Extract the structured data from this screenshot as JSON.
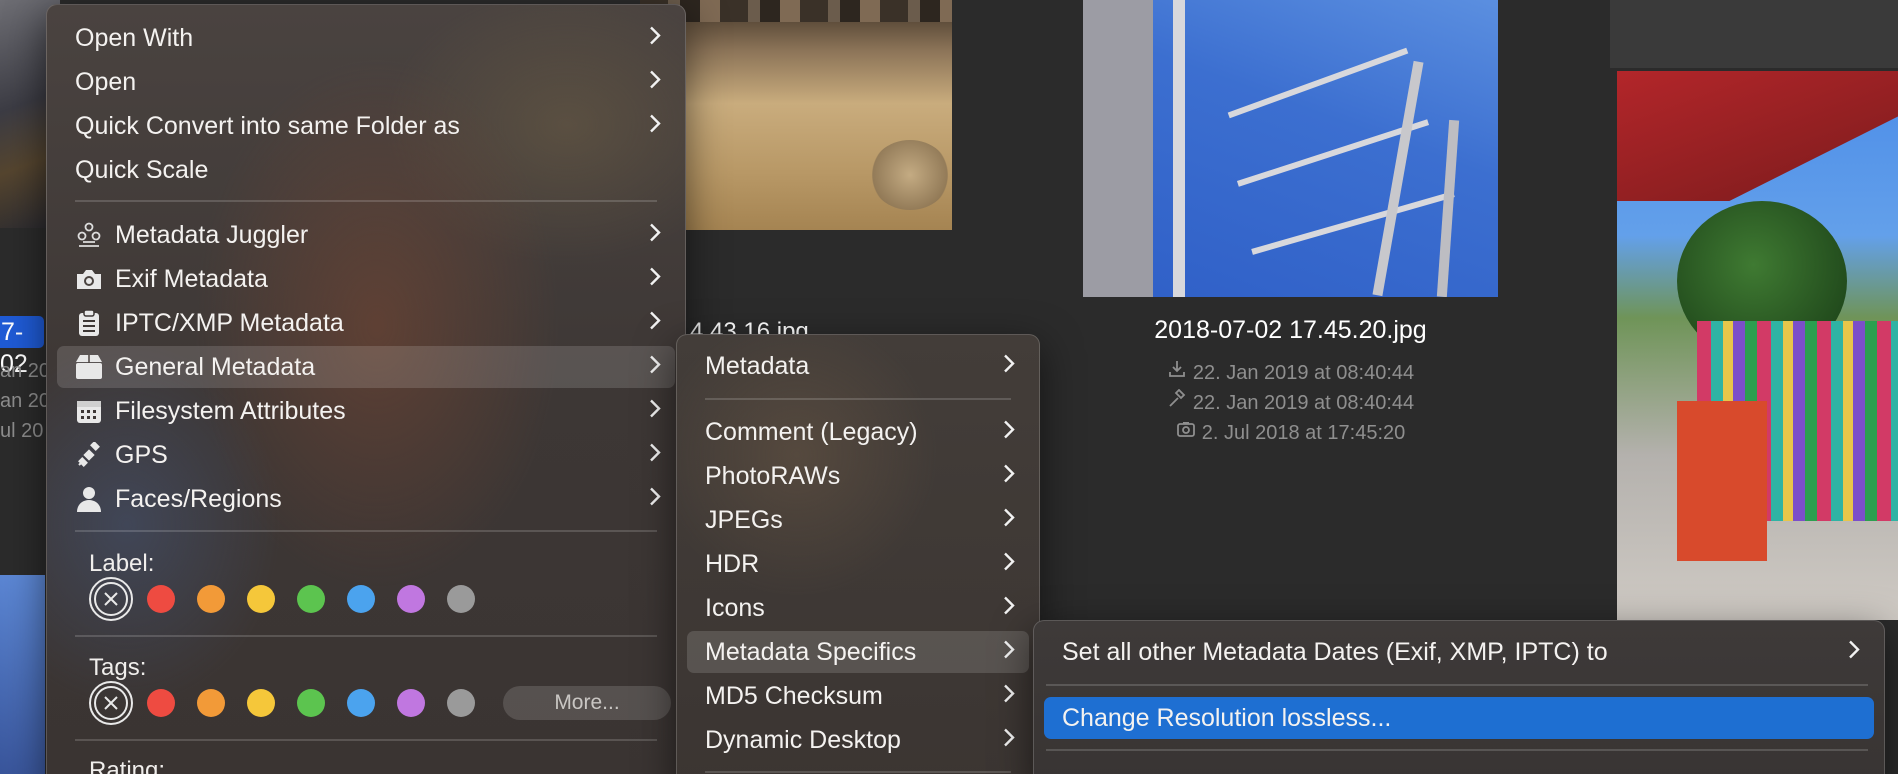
{
  "background": {
    "selected_label_partial": "7-02",
    "left_meta": [
      "an 20",
      "an 20",
      "ul 20"
    ],
    "partial_file_label": "4.43.16.jpg",
    "file": {
      "name": "2018-07-02 17.45.20.jpg",
      "dates": [
        {
          "icon": "download-icon",
          "text": "22. Jan 2019 at 08:40:44"
        },
        {
          "icon": "hammer-icon",
          "text": "22. Jan 2019 at 08:40:44"
        },
        {
          "icon": "camera-icon",
          "text": "2. Jul 2018 at 17:45:20"
        }
      ]
    }
  },
  "main_menu": {
    "items_top": [
      {
        "label": "Open With",
        "submenu": true
      },
      {
        "label": "Open",
        "submenu": true
      },
      {
        "label": "Quick Convert into same Folder as",
        "submenu": true
      },
      {
        "label": "Quick Scale",
        "submenu": false
      }
    ],
    "items_metadata": [
      {
        "label": "Metadata Juggler",
        "icon": "juggler-icon",
        "submenu": true
      },
      {
        "label": "Exif Metadata",
        "icon": "camera-icon",
        "submenu": true
      },
      {
        "label": "IPTC/XMP Metadata",
        "icon": "clipboard-icon",
        "submenu": true
      },
      {
        "label": "General Metadata",
        "icon": "box-icon",
        "submenu": true,
        "highlighted": true
      },
      {
        "label": "Filesystem Attributes",
        "icon": "calendar-icon",
        "submenu": true
      },
      {
        "label": "GPS",
        "icon": "satellite-icon",
        "submenu": true
      },
      {
        "label": "Faces/Regions",
        "icon": "person-icon",
        "submenu": true
      }
    ],
    "label_section": {
      "title": "Label:"
    },
    "tags_section": {
      "title": "Tags:",
      "more_button": "More..."
    },
    "rating_section": {
      "title": "Rating:"
    },
    "color_swatches": [
      "#ee4b41",
      "#f29a38",
      "#f5c73a",
      "#5cc44f",
      "#4ba3ee",
      "#c077e0",
      "#9a9a9a"
    ]
  },
  "submenu_general": {
    "items": [
      {
        "label": "Metadata",
        "submenu": true
      },
      {
        "label": "Comment (Legacy)",
        "submenu": true
      },
      {
        "label": "PhotoRAWs",
        "submenu": true
      },
      {
        "label": "JPEGs",
        "submenu": true
      },
      {
        "label": "HDR",
        "submenu": true
      },
      {
        "label": "Icons",
        "submenu": true
      },
      {
        "label": "Metadata Specifics",
        "submenu": true,
        "highlighted": true
      },
      {
        "label": "MD5 Checksum",
        "submenu": true
      },
      {
        "label": "Dynamic Desktop",
        "submenu": true
      }
    ]
  },
  "submenu_specifics": {
    "items": [
      {
        "label": "Set all other Metadata Dates (Exif, XMP, IPTC) to",
        "submenu": true
      },
      {
        "label": "Change Resolution lossless...",
        "submenu": false,
        "active": true
      }
    ]
  },
  "colors": {
    "accent": "#1e6fd2",
    "selection": "#1f5bd6"
  }
}
